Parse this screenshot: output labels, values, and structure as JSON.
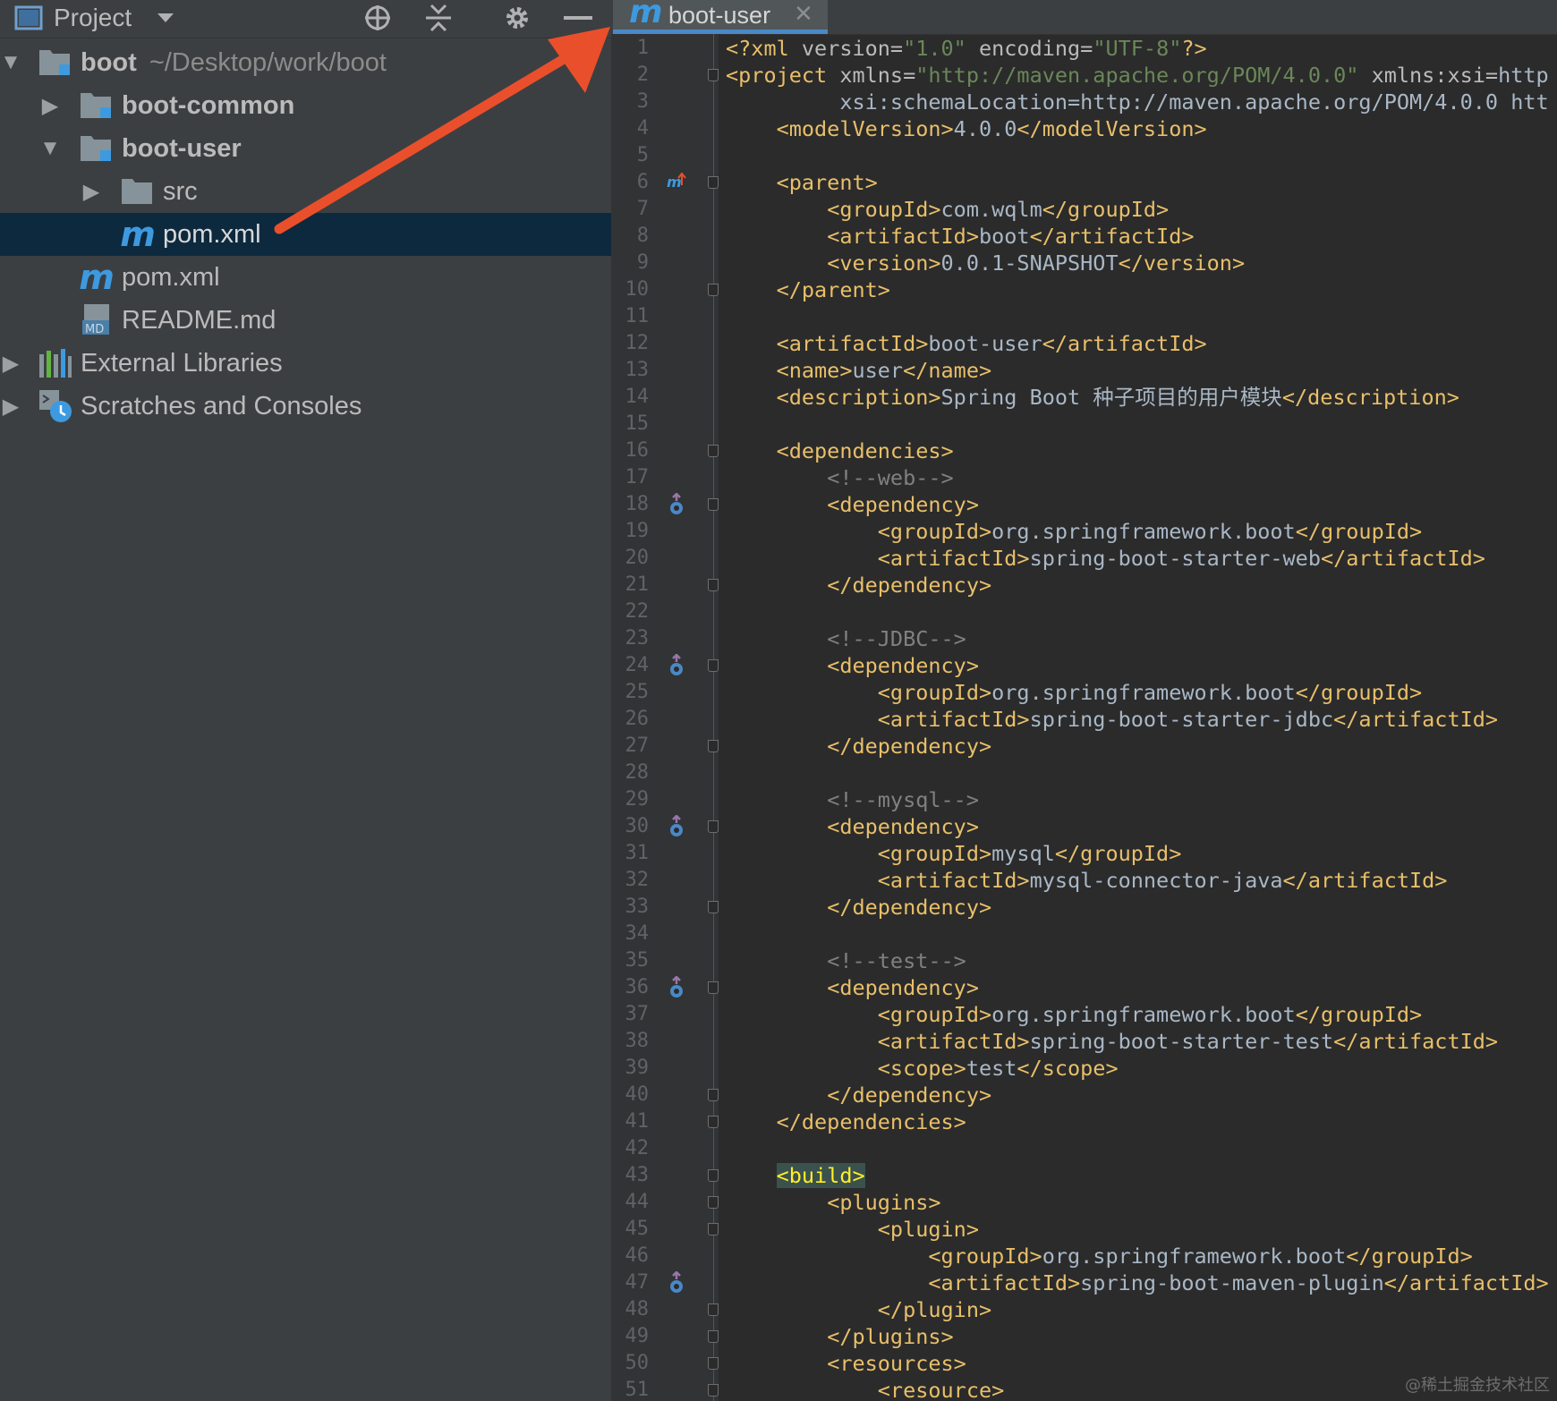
{
  "project_panel": {
    "title": "Project",
    "toolbar_icons": [
      "locate-icon",
      "collapse-all-icon",
      "gear-icon",
      "hide-icon"
    ],
    "tree": [
      {
        "label": "boot",
        "path": "~/Desktop/work/boot",
        "icon": "module-folder-icon",
        "expanded": true,
        "bold": true
      },
      {
        "label": "boot-common",
        "icon": "module-folder-icon",
        "expanded": false,
        "bold": true
      },
      {
        "label": "boot-user",
        "icon": "module-folder-icon",
        "expanded": true,
        "bold": true
      },
      {
        "label": "src",
        "icon": "folder-icon",
        "expanded": false
      },
      {
        "label": "pom.xml",
        "icon": "maven-icon",
        "selected": true
      },
      {
        "label": "pom.xml",
        "icon": "maven-icon"
      },
      {
        "label": "README.md",
        "icon": "markdown-file-icon"
      },
      {
        "label": "External Libraries",
        "icon": "libraries-icon",
        "expanded": false
      },
      {
        "label": "Scratches and Consoles",
        "icon": "scratches-icon",
        "expanded": false
      }
    ]
  },
  "editor": {
    "tab_label": "boot-user",
    "tab_icon": "maven-icon",
    "lines": [
      {
        "n": "1",
        "t": "<?xml version=\"1.0\" encoding=\"UTF-8\"?>"
      },
      {
        "n": "2",
        "t": "<project xmlns=\"http://maven.apache.org/POM/4.0.0\" xmlns:xsi=\"http"
      },
      {
        "n": "3",
        "t": "         xsi:schemaLocation=\"http://maven.apache.org/POM/4.0.0 htt"
      },
      {
        "n": "4",
        "t": "    <modelVersion>4.0.0</modelVersion>"
      },
      {
        "n": "5",
        "t": ""
      },
      {
        "n": "6",
        "t": "    <parent>"
      },
      {
        "n": "7",
        "t": "        <groupId>com.wqlm</groupId>"
      },
      {
        "n": "8",
        "t": "        <artifactId>boot</artifactId>"
      },
      {
        "n": "9",
        "t": "        <version>0.0.1-SNAPSHOT</version>"
      },
      {
        "n": "10",
        "t": "    </parent>"
      },
      {
        "n": "11",
        "t": ""
      },
      {
        "n": "12",
        "t": "    <artifactId>boot-user</artifactId>"
      },
      {
        "n": "13",
        "t": "    <name>user</name>"
      },
      {
        "n": "14",
        "t": "    <description>Spring Boot 种子项目的用户模块</description>"
      },
      {
        "n": "15",
        "t": ""
      },
      {
        "n": "16",
        "t": "    <dependencies>"
      },
      {
        "n": "17",
        "t": "        <!--web-->"
      },
      {
        "n": "18",
        "t": "        <dependency>"
      },
      {
        "n": "19",
        "t": "            <groupId>org.springframework.boot</groupId>"
      },
      {
        "n": "20",
        "t": "            <artifactId>spring-boot-starter-web</artifactId>"
      },
      {
        "n": "21",
        "t": "        </dependency>"
      },
      {
        "n": "22",
        "t": ""
      },
      {
        "n": "23",
        "t": "        <!--JDBC-->"
      },
      {
        "n": "24",
        "t": "        <dependency>"
      },
      {
        "n": "25",
        "t": "            <groupId>org.springframework.boot</groupId>"
      },
      {
        "n": "26",
        "t": "            <artifactId>spring-boot-starter-jdbc</artifactId>"
      },
      {
        "n": "27",
        "t": "        </dependency>"
      },
      {
        "n": "28",
        "t": ""
      },
      {
        "n": "29",
        "t": "        <!--mysql-->"
      },
      {
        "n": "30",
        "t": "        <dependency>"
      },
      {
        "n": "31",
        "t": "            <groupId>mysql</groupId>"
      },
      {
        "n": "32",
        "t": "            <artifactId>mysql-connector-java</artifactId>"
      },
      {
        "n": "33",
        "t": "        </dependency>"
      },
      {
        "n": "34",
        "t": ""
      },
      {
        "n": "35",
        "t": "        <!--test-->"
      },
      {
        "n": "36",
        "t": "        <dependency>"
      },
      {
        "n": "37",
        "t": "            <groupId>org.springframework.boot</groupId>"
      },
      {
        "n": "38",
        "t": "            <artifactId>spring-boot-starter-test</artifactId>"
      },
      {
        "n": "39",
        "t": "            <scope>test</scope>"
      },
      {
        "n": "40",
        "t": "        </dependency>"
      },
      {
        "n": "41",
        "t": "    </dependencies>"
      },
      {
        "n": "42",
        "t": ""
      },
      {
        "n": "43",
        "t": "    <build>"
      },
      {
        "n": "44",
        "t": "        <plugins>"
      },
      {
        "n": "45",
        "t": "            <plugin>"
      },
      {
        "n": "46",
        "t": "                <groupId>org.springframework.boot</groupId>"
      },
      {
        "n": "47",
        "t": "                <artifactId>spring-boot-maven-plugin</artifactId>"
      },
      {
        "n": "48",
        "t": "            </plugin>"
      },
      {
        "n": "49",
        "t": "        </plugins>"
      },
      {
        "n": "50",
        "t": "        <resources>"
      },
      {
        "n": "51",
        "t": "            <resource>"
      }
    ],
    "fold_markers": [
      "2",
      "6",
      "10",
      "16",
      "18",
      "21",
      "24",
      "27",
      "30",
      "33",
      "36",
      "40",
      "41",
      "43",
      "44",
      "45",
      "48",
      "49",
      "50",
      "51"
    ],
    "gutter_icons": {
      "6": "maven-parent-icon",
      "18": "dependency-icon",
      "24": "dependency-icon",
      "30": "dependency-icon",
      "36": "dependency-icon",
      "47": "dependency-icon"
    },
    "highlighted_line": "43"
  },
  "watermark": "@稀土掘金技术社区",
  "colors": {
    "tag": "#e8bf6a",
    "value": "#6a8759",
    "comment": "#808080",
    "namespace": "#9876aa",
    "selection": "#0d293e",
    "arrow": "#ea4f2b",
    "maven_icon": "#3d9ae0"
  }
}
